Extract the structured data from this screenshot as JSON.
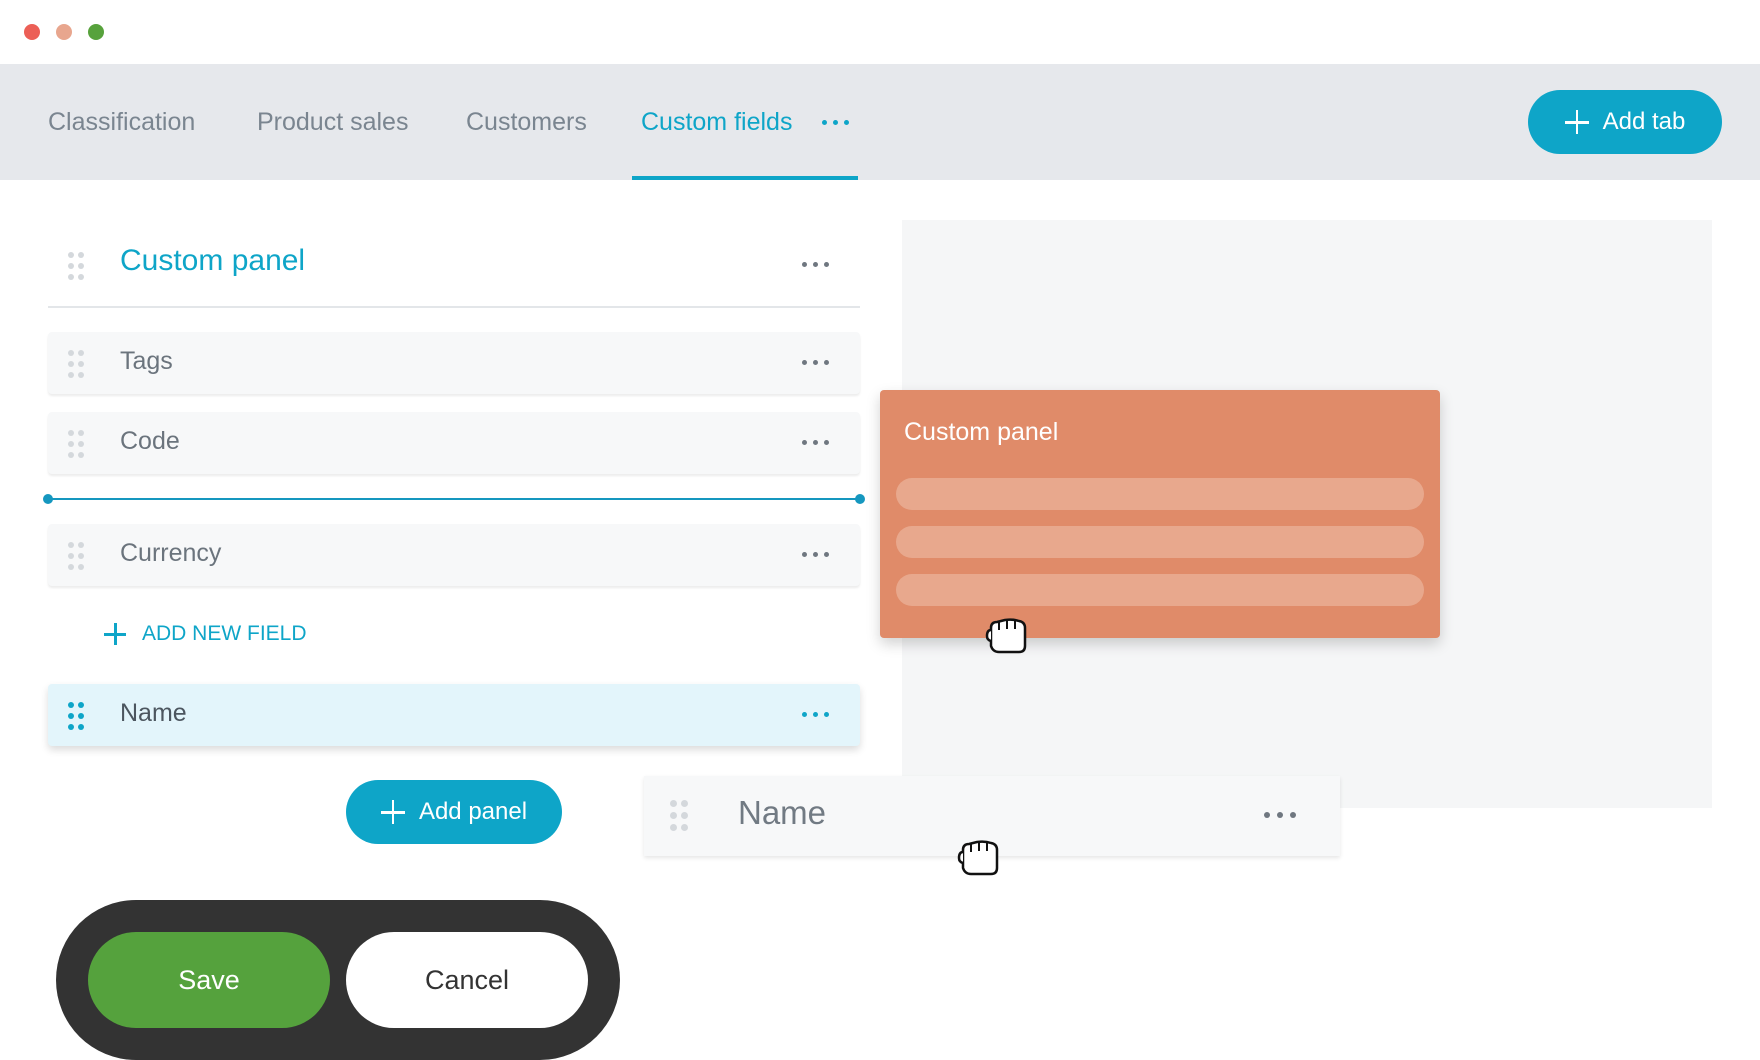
{
  "window_controls": [
    "close",
    "minimize",
    "maximize"
  ],
  "tabs": [
    {
      "label": "Classification",
      "active": false
    },
    {
      "label": "Product sales",
      "active": false
    },
    {
      "label": "Customers",
      "active": false
    },
    {
      "label": "Custom fields",
      "active": true
    }
  ],
  "add_tab_label": "Add tab",
  "panel": {
    "title": "Custom panel",
    "fields": [
      {
        "label": "Tags"
      },
      {
        "label": "Code"
      },
      {
        "label": "Currency"
      }
    ],
    "add_field_label": "ADD NEW FIELD",
    "selected_field": {
      "label": "Name"
    }
  },
  "add_panel_label": "Add panel",
  "dragging_panel": {
    "title": "Custom panel"
  },
  "dragging_field": {
    "label": "Name"
  },
  "actions": {
    "save_label": "Save",
    "cancel_label": "Cancel"
  },
  "colors": {
    "accent": "#0ea5c8",
    "tab_bar": "#e6e8ec",
    "drag_panel": "#e08b69",
    "save": "#55a23d",
    "action_bar": "#333333",
    "selected_row": "#e3f5fb"
  },
  "icons": [
    "drag-handle-icon",
    "more-horizontal-icon",
    "plus-icon",
    "grab-cursor-icon"
  ]
}
